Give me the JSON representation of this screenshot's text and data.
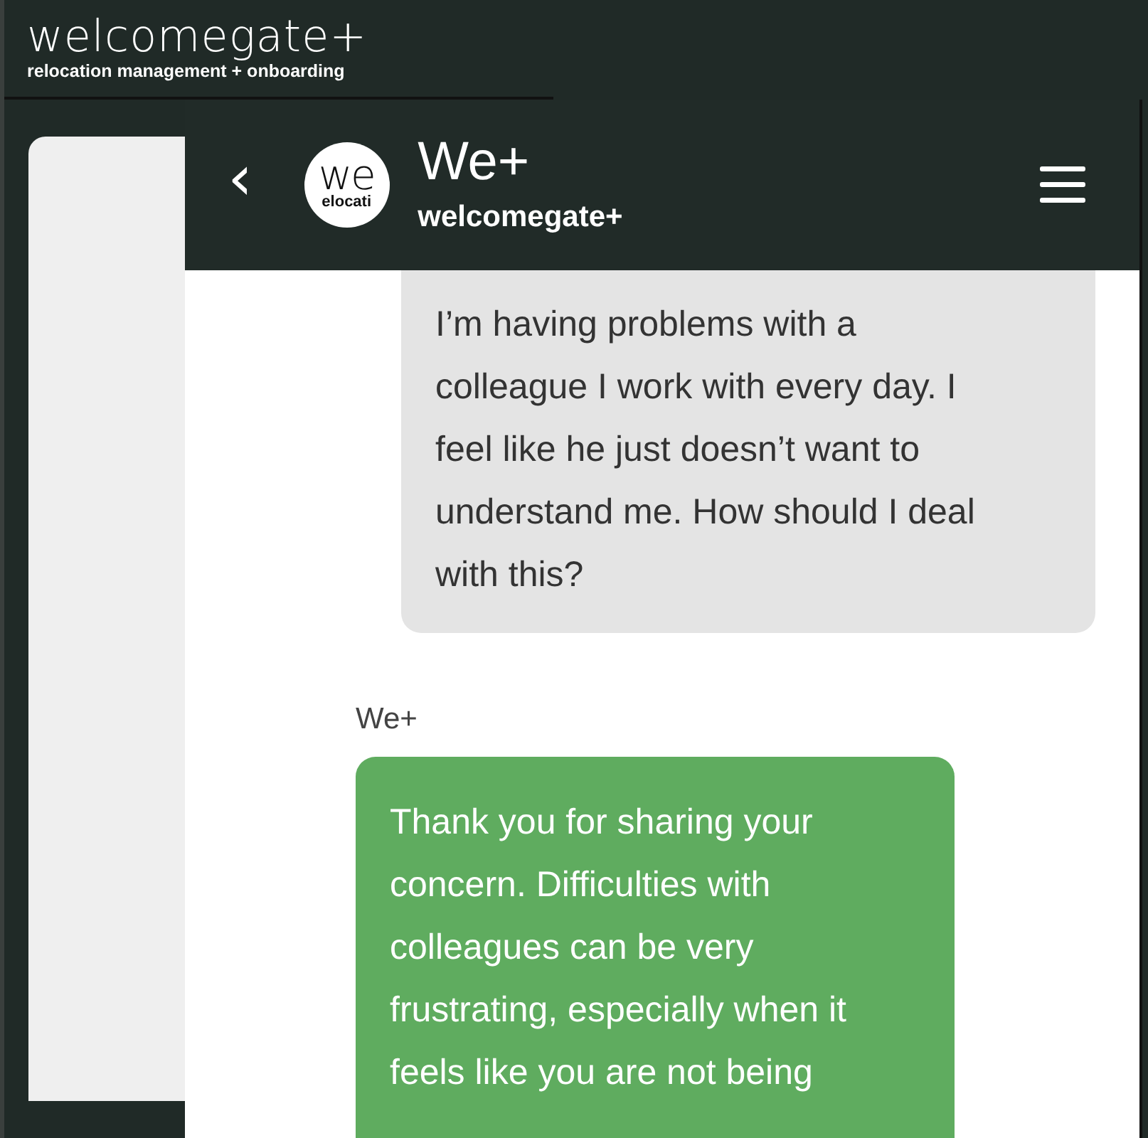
{
  "site_header": {
    "logo": "welcomegate+",
    "tagline": "relocation management + onboarding"
  },
  "chat": {
    "header": {
      "back": "‹",
      "avatar": {
        "top": "we",
        "bottom": "elocati"
      },
      "title": "We+",
      "subtitle": "welcomegate+"
    },
    "messages": [
      {
        "kind": "user",
        "lines": [
          "I’m having problems with a",
          "colleague I work with every day. I",
          "feel like he just doesn’t want to",
          "understand me. How should I deal",
          "with this?"
        ]
      },
      {
        "kind": "bot",
        "sender": "We+",
        "lines": [
          "Thank you for sharing your",
          "concern. Difficulties with",
          "colleagues can be very",
          "frustrating, especially when it",
          "feels like you are not being"
        ]
      }
    ]
  }
}
